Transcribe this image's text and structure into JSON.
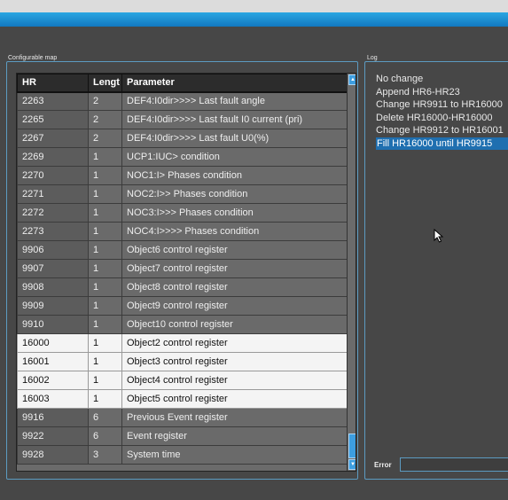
{
  "map_panel": {
    "caption": "Configurable map",
    "columns": [
      "HR",
      "Lengt",
      "Parameter"
    ],
    "rows": [
      {
        "hr": "2263",
        "len": "2",
        "param": "DEF4:I0dir>>>> Last fault angle",
        "selected": false
      },
      {
        "hr": "2265",
        "len": "2",
        "param": "DEF4:I0dir>>>> Last fault I0 current (pri)",
        "selected": false
      },
      {
        "hr": "2267",
        "len": "2",
        "param": "DEF4:I0dir>>>> Last fault U0(%)",
        "selected": false
      },
      {
        "hr": "2269",
        "len": "1",
        "param": "UCP1:IUC> condition",
        "selected": false
      },
      {
        "hr": "2270",
        "len": "1",
        "param": "NOC1:I> Phases condition",
        "selected": false
      },
      {
        "hr": "2271",
        "len": "1",
        "param": "NOC2:I>> Phases condition",
        "selected": false
      },
      {
        "hr": "2272",
        "len": "1",
        "param": "NOC3:I>>> Phases condition",
        "selected": false
      },
      {
        "hr": "2273",
        "len": "1",
        "param": "NOC4:I>>>> Phases condition",
        "selected": false
      },
      {
        "hr": "9906",
        "len": "1",
        "param": "Object6 control register",
        "selected": false
      },
      {
        "hr": "9907",
        "len": "1",
        "param": "Object7 control register",
        "selected": false
      },
      {
        "hr": "9908",
        "len": "1",
        "param": "Object8 control register",
        "selected": false
      },
      {
        "hr": "9909",
        "len": "1",
        "param": "Object9 control register",
        "selected": false
      },
      {
        "hr": "9910",
        "len": "1",
        "param": "Object10 control register",
        "selected": false
      },
      {
        "hr": "16000",
        "len": "1",
        "param": "Object2 control register",
        "selected": true
      },
      {
        "hr": "16001",
        "len": "1",
        "param": "Object3 control register",
        "selected": true
      },
      {
        "hr": "16002",
        "len": "1",
        "param": "Object4 control register",
        "selected": true
      },
      {
        "hr": "16003",
        "len": "1",
        "param": "Object5 control register",
        "selected": true
      },
      {
        "hr": "9916",
        "len": "6",
        "param": "Previous Event register",
        "selected": false
      },
      {
        "hr": "9922",
        "len": "6",
        "param": "Event register",
        "selected": false
      },
      {
        "hr": "9928",
        "len": "3",
        "param": "System time",
        "selected": false
      }
    ]
  },
  "log_panel": {
    "caption": "Log",
    "entries": [
      {
        "text": "No change",
        "selected": false
      },
      {
        "text": "Append HR6-HR23",
        "selected": false
      },
      {
        "text": "Change HR9911 to HR16000",
        "selected": false
      },
      {
        "text": "Delete HR16000-HR16000",
        "selected": false
      },
      {
        "text": "Change HR9912 to HR16001",
        "selected": false
      },
      {
        "text": "Fill HR16000 until HR9915",
        "selected": true
      }
    ],
    "error_label": "Error",
    "error_value": ""
  },
  "icons": {
    "scroll_up": "scroll-up-arrow",
    "scroll_down": "scroll-down-arrow",
    "pointer": "mouse-pointer"
  },
  "colors": {
    "accent": "#1e88d0",
    "selected_row": "#f4f4f4",
    "log_selected": "#1f6fb0"
  }
}
